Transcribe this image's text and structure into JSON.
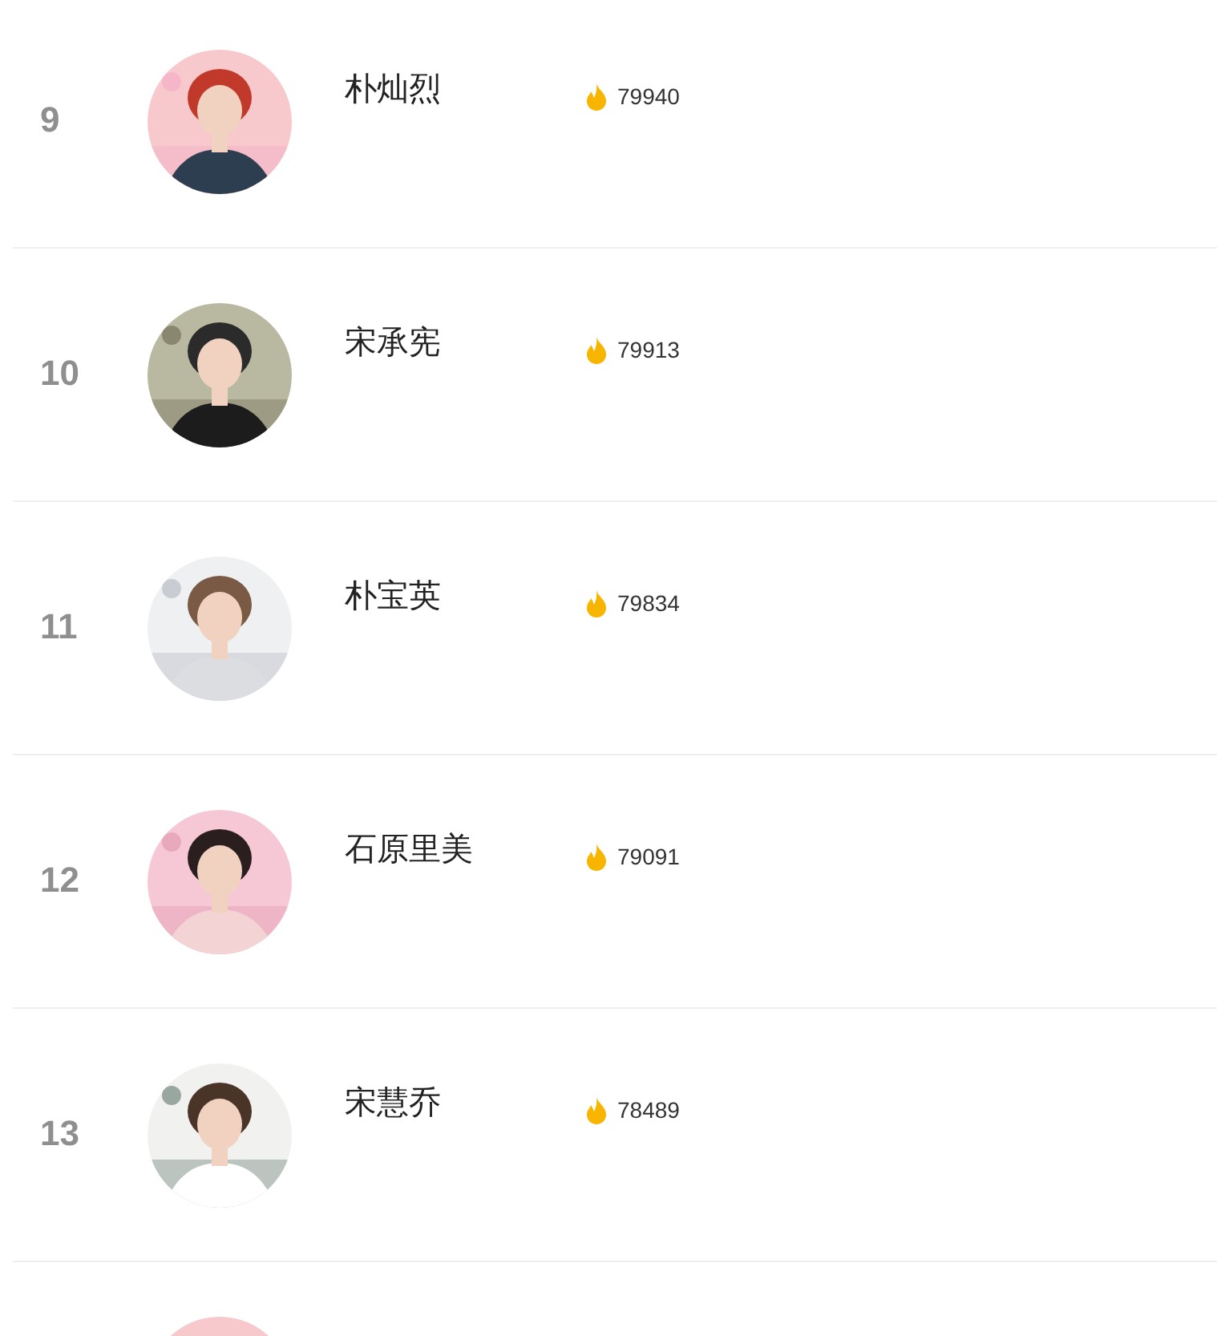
{
  "rows": [
    {
      "rank": "9",
      "name": "朴灿烈",
      "score": "79940"
    },
    {
      "rank": "10",
      "name": "宋承宪",
      "score": "79913"
    },
    {
      "rank": "11",
      "name": "朴宝英",
      "score": "79834"
    },
    {
      "rank": "12",
      "name": "石原里美",
      "score": "79091"
    },
    {
      "rank": "13",
      "name": "宋慧乔",
      "score": "78489"
    }
  ]
}
